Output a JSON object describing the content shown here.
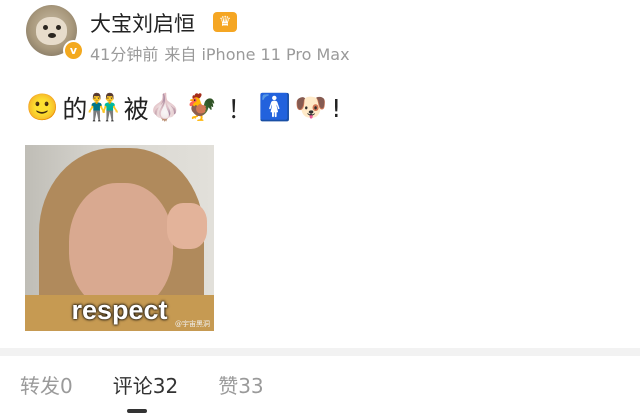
{
  "user": {
    "name": "大宝刘启恒",
    "time": "41分钟前",
    "source": "来自 iPhone 11 Pro Max",
    "verified_mark": "v"
  },
  "post": {
    "text_parts": [
      "的",
      "被",
      "！",
      "!"
    ],
    "emojis": [
      "🙂",
      "👬",
      "🧄",
      "🐓",
      "🚺",
      "🐶"
    ]
  },
  "image": {
    "caption": "respect",
    "watermark": "@宇宙黑洞"
  },
  "tabs": [
    {
      "label": "转发",
      "count": "0"
    },
    {
      "label": "评论",
      "count": "32"
    },
    {
      "label": "赞",
      "count": "33"
    }
  ],
  "colors": {
    "accent": "#f5a623",
    "muted": "#9a9a9a",
    "text": "#222222"
  }
}
